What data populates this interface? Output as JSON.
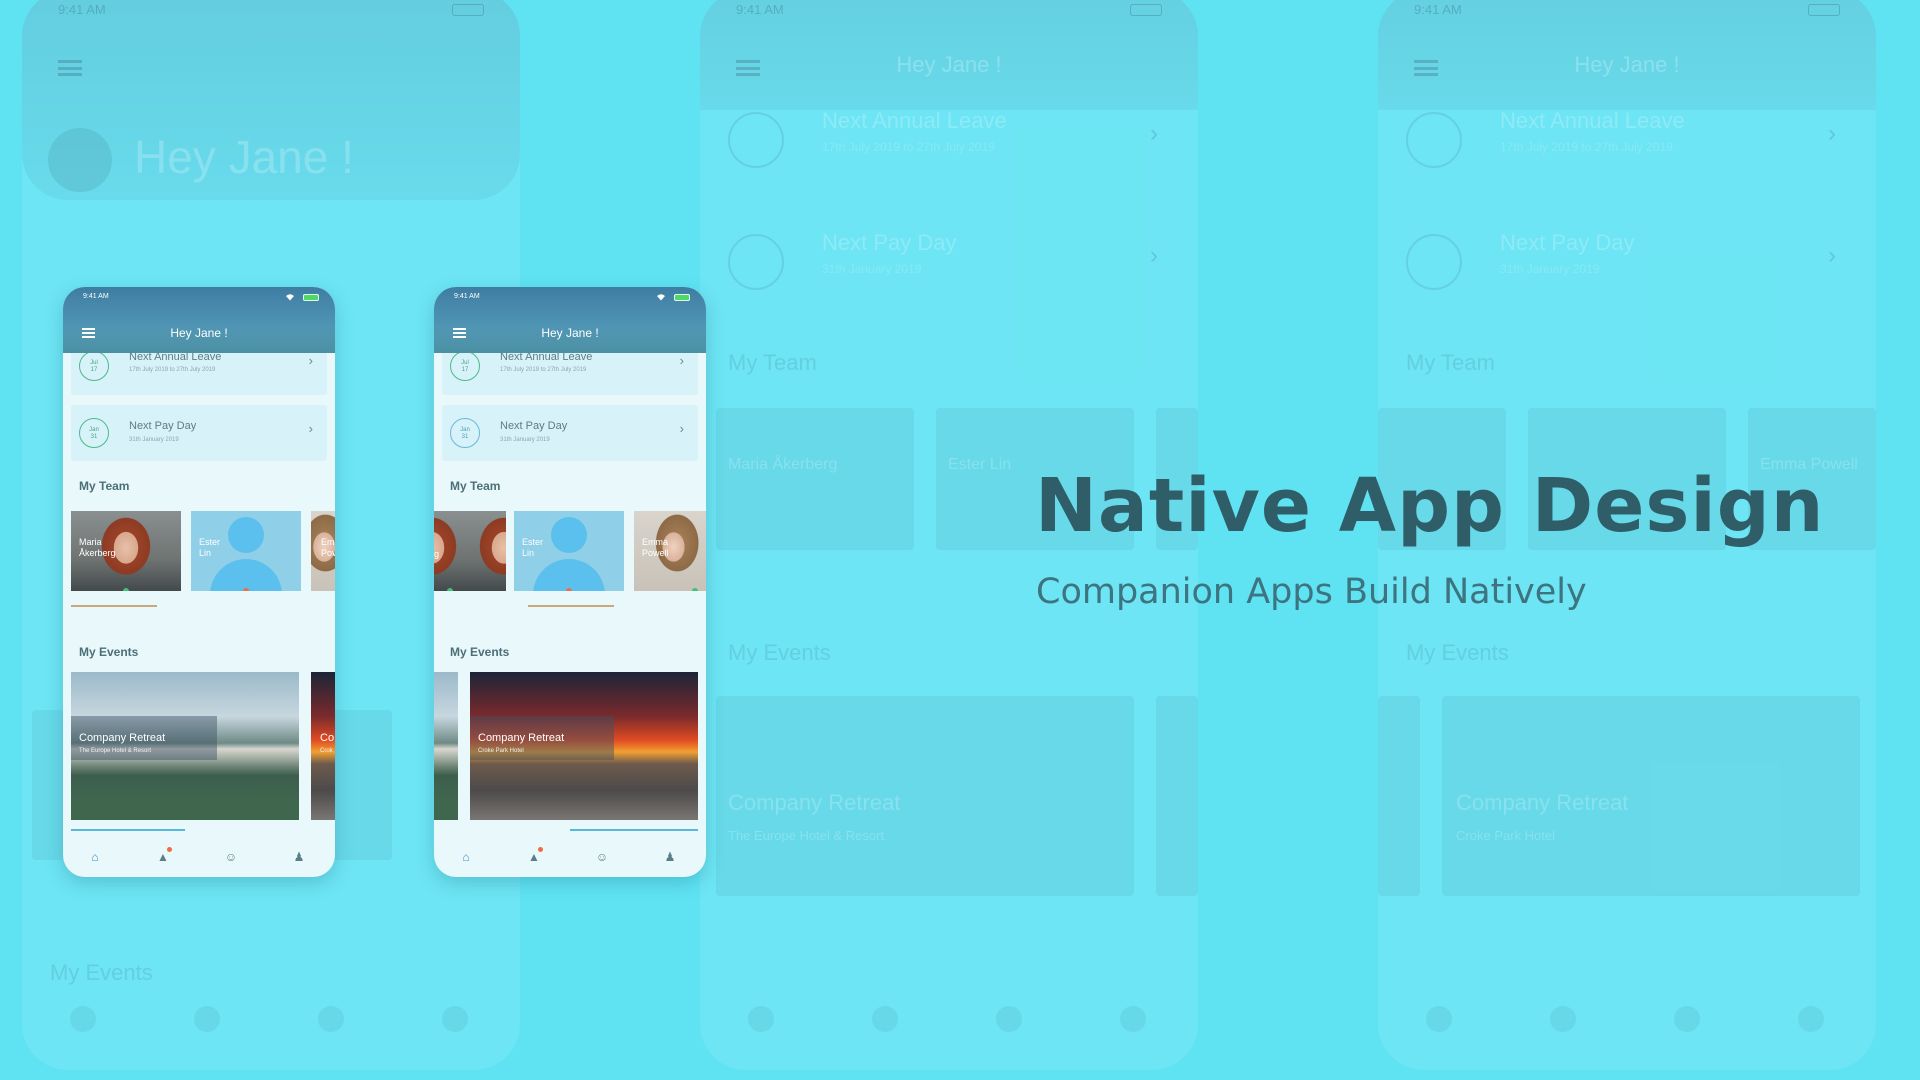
{
  "colors": {
    "background": "#5fe3f3",
    "accent": "#4cba8b",
    "title": "#2f5e68"
  },
  "hero": {
    "title": "Native App Design",
    "subtitle": "Companion Apps Build Natively"
  },
  "status_bar": {
    "time": "9:41 AM"
  },
  "app": {
    "greeting": "Hey Jane !",
    "leave": {
      "title": "Next Annual Leave",
      "subtitle": "17th July 2019 to 27th July 2019",
      "month": "Jul",
      "day": "17"
    },
    "payday": {
      "title": "Next Pay Day",
      "subtitle": "31th January 2019",
      "month": "Jan",
      "day": "31"
    },
    "team_section": "My Team",
    "team": [
      {
        "name_line1": "Maria",
        "name_line2": "Åkerberg"
      },
      {
        "name_line1": "Ester",
        "name_line2": "Lin"
      },
      {
        "name_line1": "Emma",
        "name_line2": "Powell"
      }
    ],
    "events_section": "My Events",
    "events": [
      {
        "title": "Company Retreat",
        "subtitle": "The Europe Hotel & Resort"
      },
      {
        "title": "Company Retreat",
        "subtitle": "Croke Park Hotel"
      }
    ],
    "nav": [
      "home-icon",
      "bell-icon",
      "smiley-icon",
      "team-icon"
    ]
  },
  "phone1_team": {
    "tile1_line1": "Maria",
    "tile1_line2": "Åkerberg",
    "tile2_line1": "Ester",
    "tile2_line2": "Lin",
    "tile3_line1": "Emi",
    "tile3_line2": "Pov"
  },
  "phone2_team": {
    "tile1_line2": "erg",
    "tile2_line1": "Ester",
    "tile2_line2": "Lin",
    "tile3_line1": "Emma",
    "tile3_line2": "Powell"
  },
  "phone1_events": {
    "peek_title": "Co",
    "peek_sub": "Crok"
  },
  "background_phone": {
    "hey_large": "Hey Jane !",
    "leave": "Next Annual Leave",
    "leave_sub": "17th July 2019 to 27th July 2019",
    "pay": "Next Pay Day",
    "pay_sub": "31th January 2019",
    "team": "My Team",
    "events": "My Events",
    "event_title": "Company Retreat",
    "event_sub_1": "The Europe Hotel & Resort",
    "event_sub_2": "Croke Park Hotel",
    "team_name_1": "Maria Åkerberg",
    "team_name_2": "Ester Lin",
    "team_name_3": "Emma Powell"
  }
}
